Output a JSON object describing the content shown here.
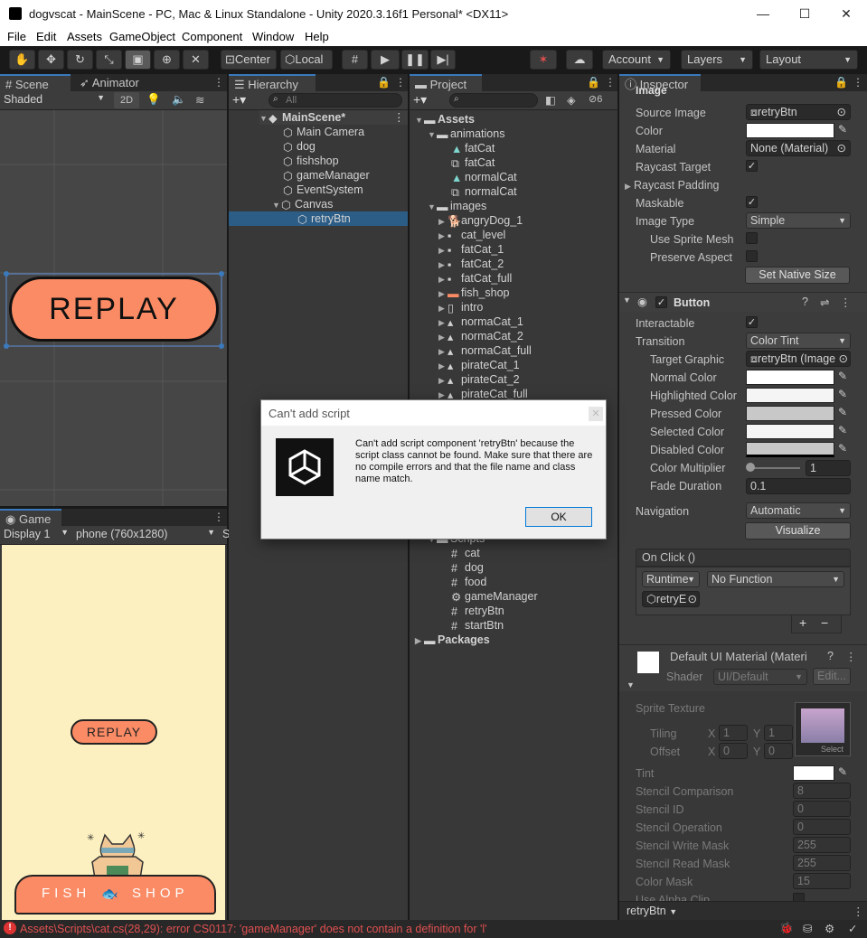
{
  "window": {
    "title": "dogvscat - MainScene - PC, Mac & Linux Standalone - Unity 2020.3.16f1 Personal* <DX11>",
    "minimize": "—",
    "maximize": "☐",
    "close": "✕"
  },
  "menu": [
    "File",
    "Edit",
    "Assets",
    "GameObject",
    "Component",
    "Window",
    "Help"
  ],
  "toolbar": {
    "center": "Center",
    "local": "Local",
    "account": "Account",
    "layers": "Layers",
    "layout": "Layout"
  },
  "scene": {
    "tab": "Scene",
    "tab2": "Animator",
    "shading": "Shaded",
    "mode2d": "2D",
    "button_text": "REPLAY"
  },
  "game": {
    "tab": "Game",
    "display": "Display 1",
    "resolution": "phone (760x1280)",
    "scale": "S",
    "replay": "REPLAY",
    "shop": "FISH  SHOP",
    "shop_left": "FISH",
    "shop_right": "SHOP"
  },
  "hierarchy": {
    "tab": "Hierarchy",
    "search_placeholder": "All",
    "scene": "MainScene*",
    "items": [
      "Main Camera",
      "dog",
      "fishshop",
      "gameManager",
      "EventSystem",
      "Canvas",
      "retryBtn"
    ]
  },
  "project": {
    "tab": "Project",
    "hidden_count": "6",
    "assets": "Assets",
    "animations": "animations",
    "anim_items": [
      "fatCat",
      "fatCat",
      "normalCat",
      "normalCat"
    ],
    "images": "images",
    "image_items": [
      "angryDog_1",
      "cat_level",
      "fatCat_1",
      "fatCat_2",
      "fatCat_full",
      "fish_shop",
      "intro",
      "normaCat_1",
      "normaCat_2",
      "normaCat_full",
      "pirateCat_1",
      "pirateCat_2",
      "pirateCat_full"
    ],
    "scripts": "Scripts",
    "script_items": [
      "cat",
      "dog",
      "food",
      "gameManager",
      "retryBtn",
      "startBtn"
    ],
    "packages": "Packages"
  },
  "dialog": {
    "title": "Can't add script",
    "message": "Can't add script component 'retryBtn' because the script class cannot be found. Make sure that there are no compile errors and that the file name and class name match.",
    "ok": "OK"
  },
  "inspector": {
    "tab": "Inspector",
    "image_header": "Image",
    "image_fields": [
      {
        "label": "Source Image",
        "value": "retryBtn"
      },
      {
        "label": "Color",
        "value": ""
      },
      {
        "label": "Material",
        "value": "None (Material)"
      },
      {
        "label": "Raycast Target",
        "value": "✓"
      },
      {
        "label": "Raycast Padding",
        "value": ""
      },
      {
        "label": "Maskable",
        "value": "✓"
      },
      {
        "label": "Image Type",
        "value": "Simple"
      },
      {
        "label": "Use Sprite Mesh",
        "value": ""
      },
      {
        "label": "Preserve Aspect",
        "value": ""
      }
    ],
    "set_native": "Set Native Size",
    "button_header": "Button",
    "interactable": "Interactable",
    "transition": "Transition",
    "transition_value": "Color Tint",
    "target_graphic": "Target Graphic",
    "target_graphic_value": "retryBtn (Image",
    "colors": [
      "Normal Color",
      "Highlighted Color",
      "Pressed Color",
      "Selected Color",
      "Disabled Color"
    ],
    "color_values": [
      "#ffffff",
      "#f5f5f5",
      "#c8c8c8",
      "#f5f5f5",
      "#c8c8c8"
    ],
    "color_multiplier": "Color Multiplier",
    "color_multiplier_value": "1",
    "fade_duration": "Fade Duration",
    "fade_duration_value": "0.1",
    "navigation": "Navigation",
    "navigation_value": "Automatic",
    "visualize": "Visualize",
    "onclick": "On Click ()",
    "runtime": "Runtime",
    "nofunction": "No Function",
    "target_obj": "retryE",
    "plus": "+",
    "minus": "−",
    "material_title": "Default UI Material (Materi",
    "shader_label": "Shader",
    "shader_value": "UI/Default",
    "edit": "Edit...",
    "sprite_texture": "Sprite Texture",
    "select": "Select",
    "tiling": "Tiling",
    "offset": "Offset",
    "x": "X",
    "y": "Y",
    "tiling_x": "1",
    "tiling_y": "1",
    "offset_x": "0",
    "offset_y": "0",
    "material_rows": [
      {
        "label": "Tint",
        "value": ""
      },
      {
        "label": "Stencil Comparison",
        "value": "8"
      },
      {
        "label": "Stencil ID",
        "value": "0"
      },
      {
        "label": "Stencil Operation",
        "value": "0"
      },
      {
        "label": "Stencil Write Mask",
        "value": "255"
      },
      {
        "label": "Stencil Read Mask",
        "value": "255"
      },
      {
        "label": "Color Mask",
        "value": "15"
      },
      {
        "label": "Use Alpha Clip",
        "value": ""
      }
    ],
    "footer": "retryBtn"
  },
  "status": {
    "error": "Assets\\Scripts\\cat.cs(28,29): error CS0117: 'gameManager' does not contain a definition for 'l'"
  }
}
